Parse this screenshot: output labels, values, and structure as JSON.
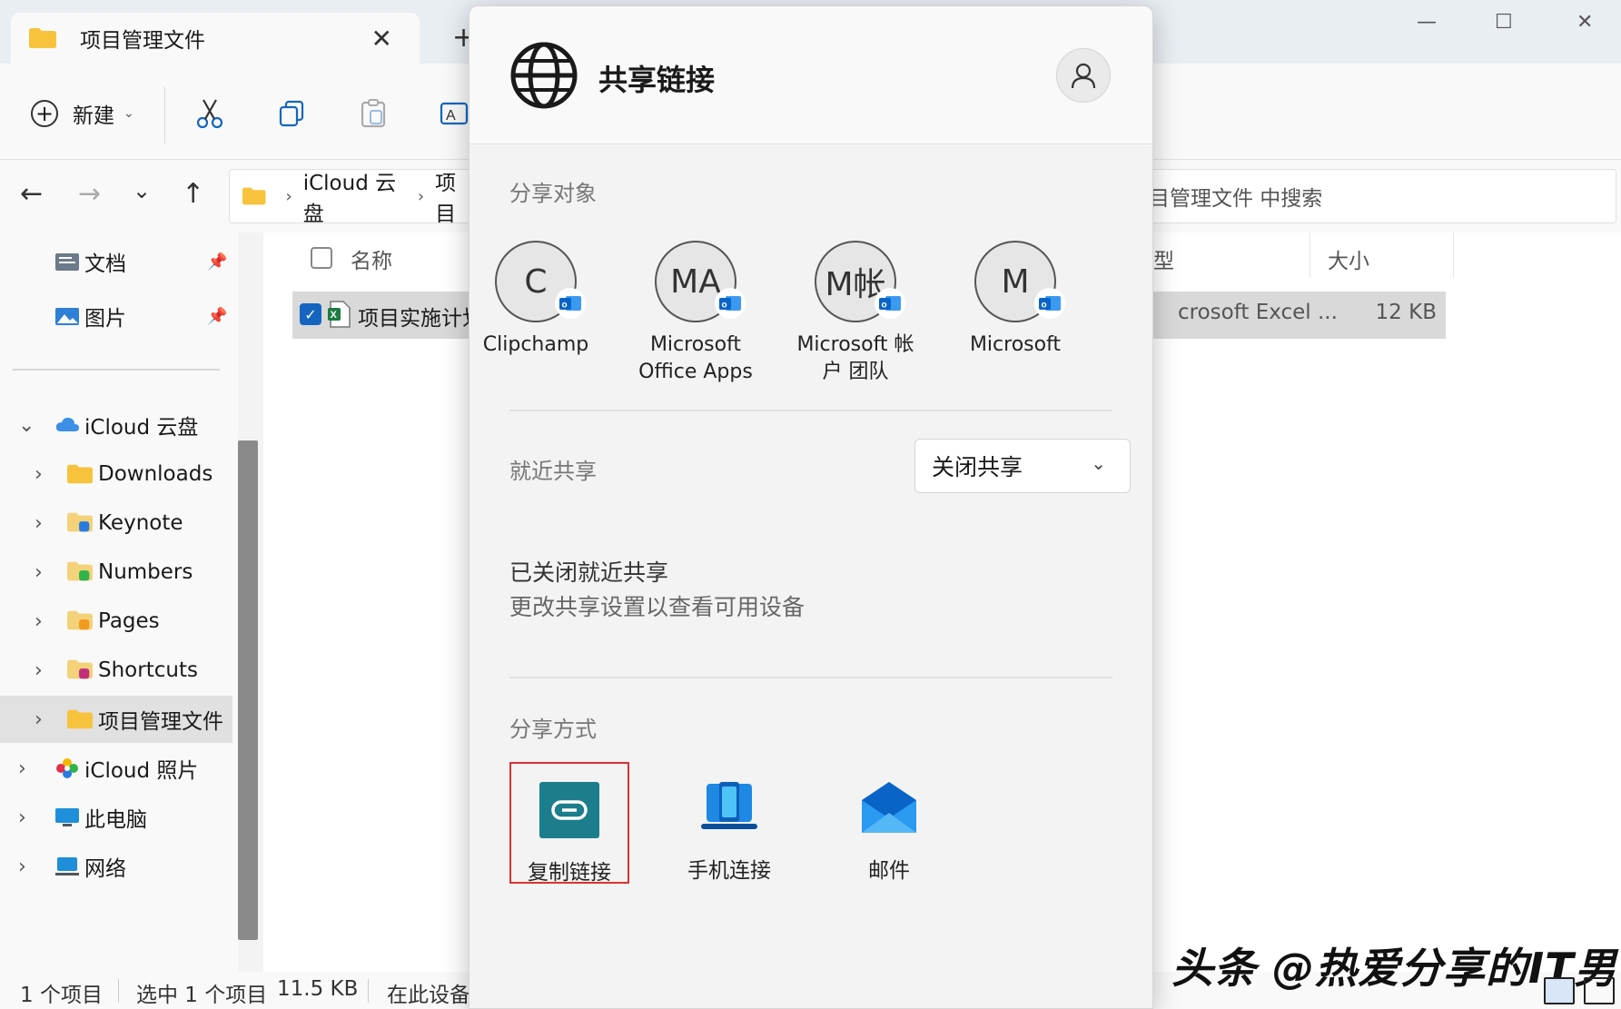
{
  "window": {
    "tab_title": "项目管理文件",
    "close_glyph": "✕",
    "newtab_glyph": "+",
    "minimize_glyph": "—",
    "maximize_glyph": "☐",
    "closewin_glyph": "✕"
  },
  "toolbar": {
    "new_label": "新建",
    "new_glyph": "+",
    "chevron": "⌄"
  },
  "address": {
    "back": "←",
    "forward": "→",
    "recent": "⌄",
    "up": "↑",
    "crumbs": [
      "iCloud 云盘",
      "项目"
    ],
    "search_placeholder": "目管理文件 中搜索"
  },
  "sidebar": {
    "pinned": [
      {
        "label": "文档",
        "pin": "📌"
      },
      {
        "label": "图片",
        "pin": "📌"
      }
    ],
    "tree": [
      {
        "label": "iCloud 云盘",
        "expander": "⌄"
      },
      {
        "label": "Downloads",
        "expander": "›"
      },
      {
        "label": "Keynote",
        "expander": "›"
      },
      {
        "label": "Numbers",
        "expander": "›"
      },
      {
        "label": "Pages",
        "expander": "›"
      },
      {
        "label": "Shortcuts",
        "expander": "›"
      },
      {
        "label": "项目管理文件",
        "expander": "›"
      },
      {
        "label": "iCloud 照片",
        "expander": "›"
      },
      {
        "label": "此电脑",
        "expander": "›"
      },
      {
        "label": "网络",
        "expander": "›"
      }
    ]
  },
  "filelist": {
    "col_name": "名称",
    "col_type": "型",
    "col_size": "大小",
    "check": "✓",
    "file": {
      "name": "项目实施计划",
      "type": "crosoft Excel ...",
      "size": "12 KB"
    }
  },
  "status": {
    "count": "1 个项目",
    "selected": "选中 1 个项目",
    "size": "11.5 KB",
    "location": "在此设备"
  },
  "watermark": "头条 @热爱分享的IT男",
  "share": {
    "title": "共享链接",
    "share_to_heading": "分享对象",
    "contacts": [
      {
        "initial": "C",
        "name": "Clipchamp"
      },
      {
        "initial": "MA",
        "name": "Microsoft Office Apps"
      },
      {
        "initial": "M帐",
        "name": "Microsoft 帐户 团队"
      },
      {
        "initial": "M",
        "name": "Microsoft"
      }
    ],
    "outlook_letter": "o",
    "nearby_heading": "就近共享",
    "nearby_dropdown": "关闭共享",
    "dropdown_chevron": "⌄",
    "nearby_off": "已关闭就近共享",
    "nearby_hint": "更改共享设置以查看可用设备",
    "methods_heading": "分享方式",
    "methods": [
      {
        "label": "复制链接",
        "icon": "link-icon"
      },
      {
        "label": "手机连接",
        "icon": "phone-link-icon"
      },
      {
        "label": "邮件",
        "icon": "mail-icon"
      }
    ]
  },
  "colors": {
    "copy_link_tile": "#1c7d8c",
    "highlight_border": "#e03030",
    "outlook_blue": "#0a64c8",
    "folder_yellow": "#f8c33c"
  }
}
